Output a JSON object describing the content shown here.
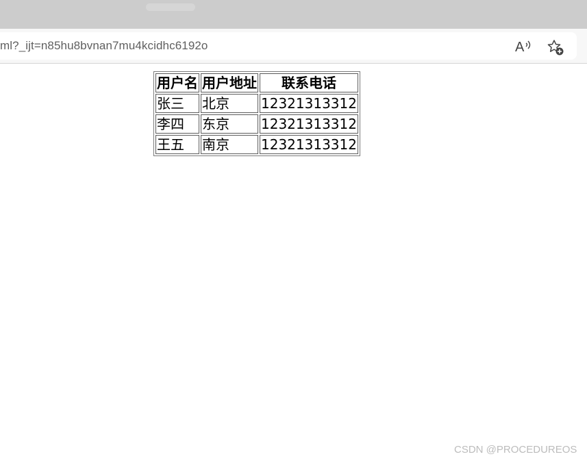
{
  "browser": {
    "url": "ml?_ijt=n85hu8bvnan7mu4kcidhc6192o",
    "read_aloud_glyph": "A",
    "icons": [
      "read-aloud-icon",
      "add-favorite-icon"
    ]
  },
  "table": {
    "headers": [
      "用户名",
      "用户地址",
      "联系电话"
    ],
    "rows": [
      [
        "张三",
        "北京",
        "12321313312"
      ],
      [
        "李四",
        "东京",
        "12321313312"
      ],
      [
        "王五",
        "南京",
        "12321313312"
      ]
    ]
  },
  "watermark": "CSDN @PROCEDUREOS"
}
